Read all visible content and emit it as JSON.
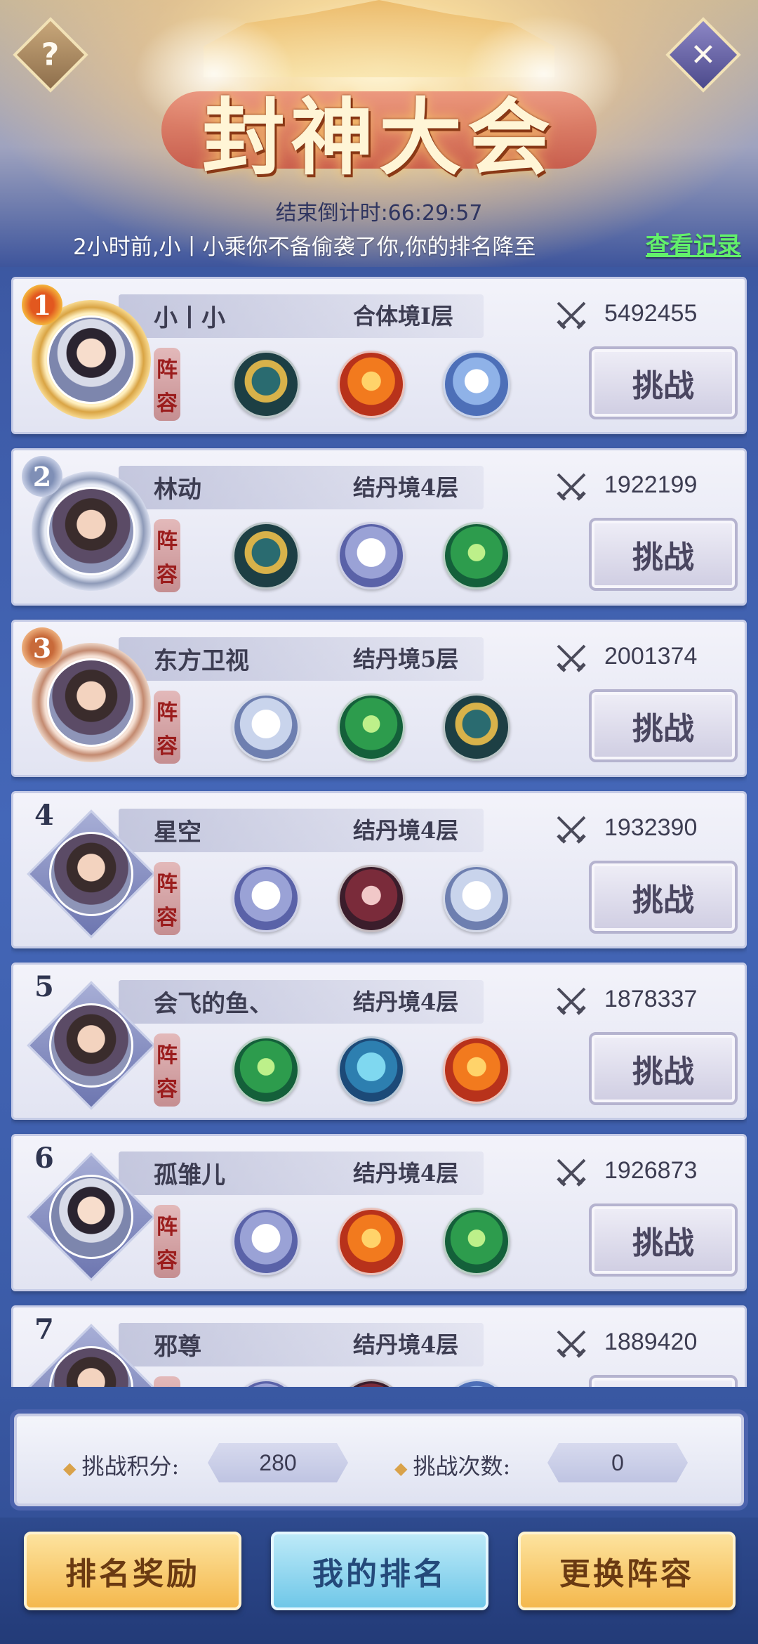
{
  "header": {
    "title": "封神大会",
    "help_icon": "?",
    "close_icon": "✕",
    "countdown": "结束倒计时:66:29:57",
    "notice": "2小时前,小丨小乘你不备偷袭了你,你的排名降至",
    "record_link": "查看记录"
  },
  "lineup_label": [
    "阵",
    "容"
  ],
  "challenge_label": "挑战",
  "players": [
    {
      "rank": "1",
      "name": "小丨小",
      "realm": "合体境Ⅰ层",
      "power": "5492455",
      "beasts": [
        "kirin",
        "phoenix",
        "dragon"
      ]
    },
    {
      "rank": "2",
      "name": "林动",
      "realm": "结丹境4层",
      "power": "1922199",
      "beasts": [
        "kirin",
        "wolf",
        "green-dragon"
      ]
    },
    {
      "rank": "3",
      "name": "东方卫视",
      "realm": "结丹境5层",
      "power": "2001374",
      "beasts": [
        "tiger",
        "green-dragon",
        "kirin"
      ]
    },
    {
      "rank": "4",
      "name": "星空",
      "realm": "结丹境4层",
      "power": "1932390",
      "beasts": [
        "wolf",
        "beast",
        "tiger"
      ]
    },
    {
      "rank": "5",
      "name": "会飞的鱼、",
      "realm": "结丹境4层",
      "power": "1878337",
      "beasts": [
        "green-dragon",
        "whale",
        "phoenix"
      ]
    },
    {
      "rank": "6",
      "name": "孤雏儿",
      "realm": "结丹境4层",
      "power": "1926873",
      "beasts": [
        "wolf",
        "phoenix",
        "green-dragon"
      ]
    },
    {
      "rank": "7",
      "name": "邪尊",
      "realm": "结丹境4层",
      "power": "1889420",
      "beasts": [
        "wolf",
        "beast",
        "dragon"
      ]
    }
  ],
  "stats": {
    "score_label": "挑战积分:",
    "score_value": "280",
    "count_label": "挑战次数:",
    "count_value": "0"
  },
  "buttons": {
    "rewards": "排名奖励",
    "my_rank": "我的排名",
    "change_lineup": "更换阵容"
  },
  "colors": {
    "accent_green": "#62f06b",
    "gold": "#f4b84d",
    "blue_button": "#6fc7e8",
    "panel_bg": "#3d5aa6"
  }
}
